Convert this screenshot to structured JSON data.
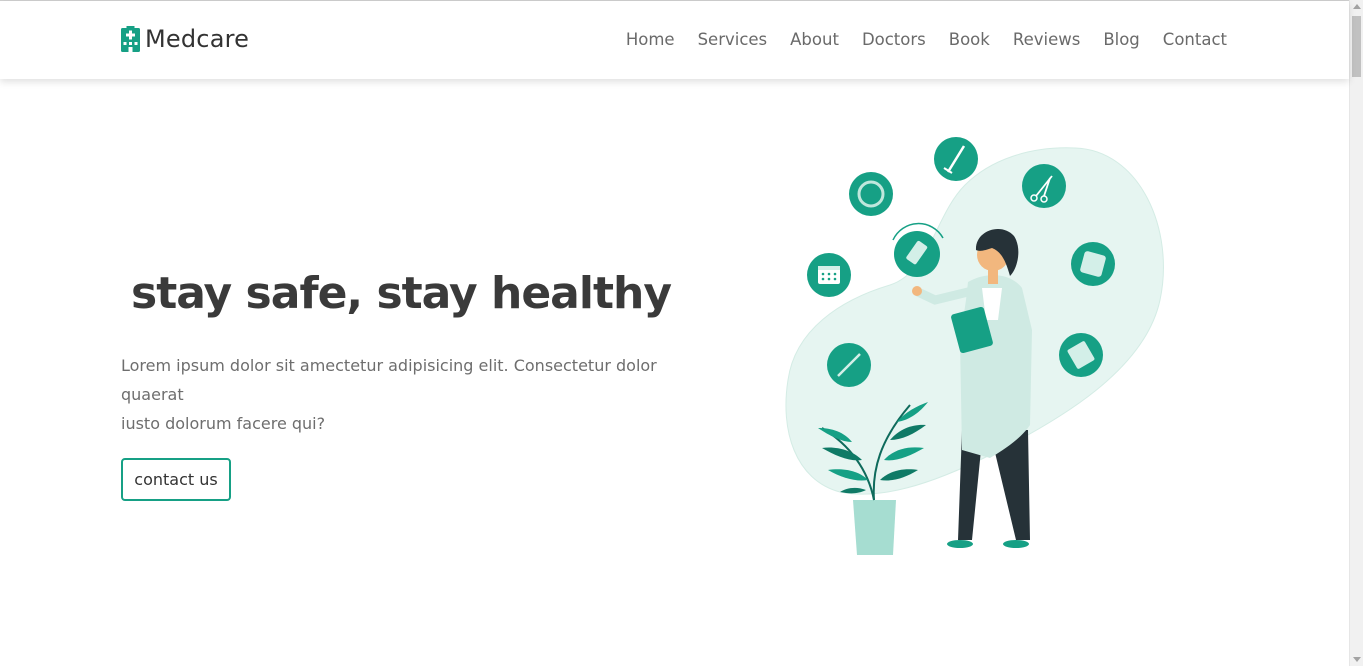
{
  "brand": {
    "name": "Medcare",
    "accent_color": "#16a085",
    "logo_icon": "hospital-icon"
  },
  "nav": {
    "items": [
      "Home",
      "Services",
      "About",
      "Doctors",
      "Book",
      "Reviews",
      "Blog",
      "Contact"
    ]
  },
  "hero": {
    "title": "stay safe, stay healthy",
    "text_line1": "Lorem ipsum dolor sit amectetur adipisicing elit. Consectetur dolor quaerat",
    "text_line2": "iusto dolorum facere qui?",
    "button_label": "contact us",
    "illustration": "doctor-with-medical-icons-illustration"
  }
}
